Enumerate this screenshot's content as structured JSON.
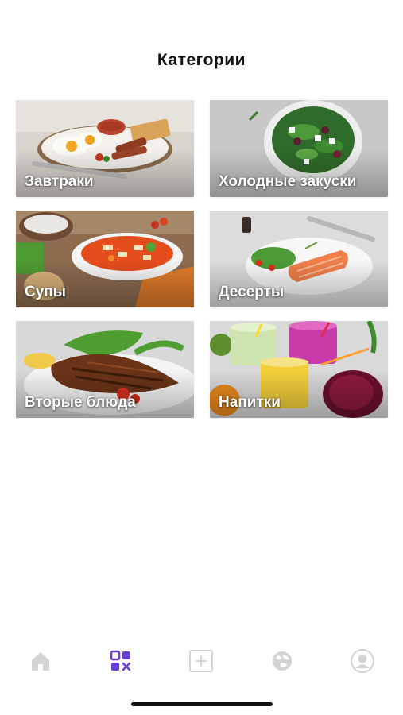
{
  "header": {
    "title": "Категории"
  },
  "categories": [
    {
      "label": "Завтраки",
      "image": "breakfast-photo"
    },
    {
      "label": "Холодные закуски",
      "image": "salad-photo"
    },
    {
      "label": "Супы",
      "image": "soup-photo"
    },
    {
      "label": "Десерты",
      "image": "salmon-plate-photo"
    },
    {
      "label": "Вторые блюда",
      "image": "grilled-fish-photo"
    },
    {
      "label": "Напитки",
      "image": "smoothies-photo"
    }
  ],
  "tabbar": {
    "active": "categories",
    "accent_color": "#6A3FD8",
    "inactive_color": "#D0D0D0",
    "tabs": [
      {
        "id": "home",
        "icon": "home-icon"
      },
      {
        "id": "categories",
        "icon": "categories-grid-icon"
      },
      {
        "id": "add",
        "icon": "add-square-icon"
      },
      {
        "id": "globe",
        "icon": "globe-icon"
      },
      {
        "id": "profile",
        "icon": "profile-icon"
      }
    ]
  }
}
